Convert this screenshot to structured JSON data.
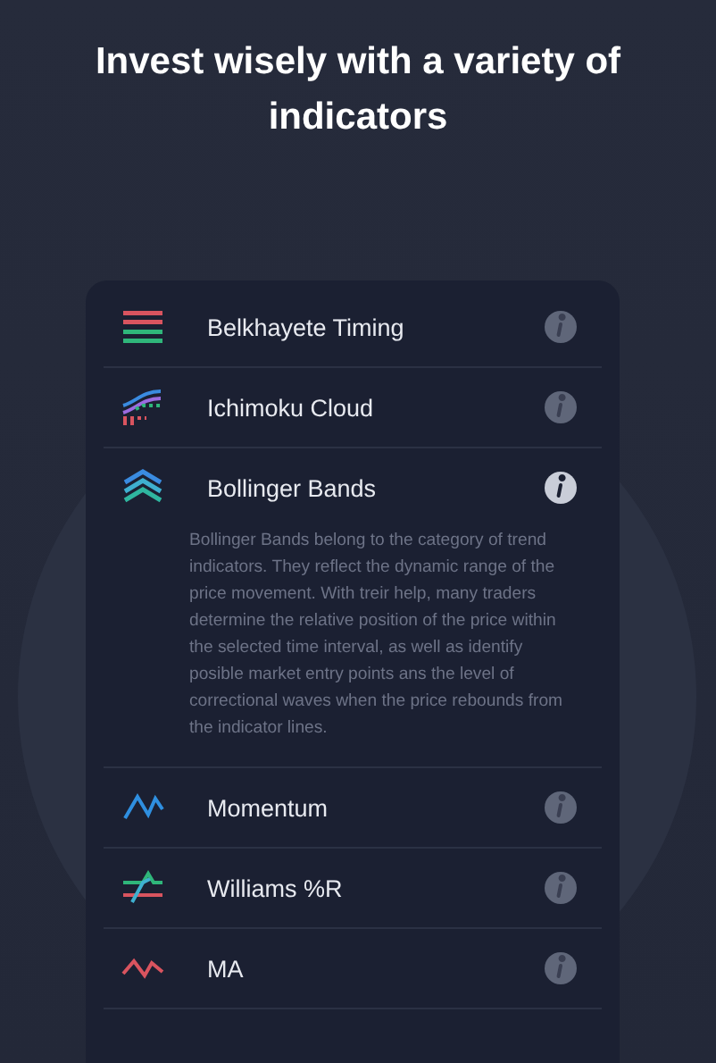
{
  "heading": "Invest wisely with a variety of indicators",
  "indicators": [
    {
      "kind": "belkhayete",
      "name": "Belkhayete Timing",
      "expanded": false
    },
    {
      "kind": "ichimoku",
      "name": "Ichimoku Cloud",
      "expanded": false
    },
    {
      "kind": "bollinger",
      "name": "Bollinger Bands",
      "expanded": true,
      "description": "Bollinger Bands belong to the category of trend indicators. They reflect the dynamic range of the price movement. With treir help, many traders determine the relative position of the price within the selected time interval, as well as identify posible market entry points ans the level of correctional waves when the price rebounds from the indicator lines."
    },
    {
      "kind": "momentum",
      "name": "Momentum",
      "expanded": false
    },
    {
      "kind": "williams",
      "name": "Williams %R",
      "expanded": false
    },
    {
      "kind": "ma",
      "name": "MA",
      "expanded": false
    }
  ]
}
